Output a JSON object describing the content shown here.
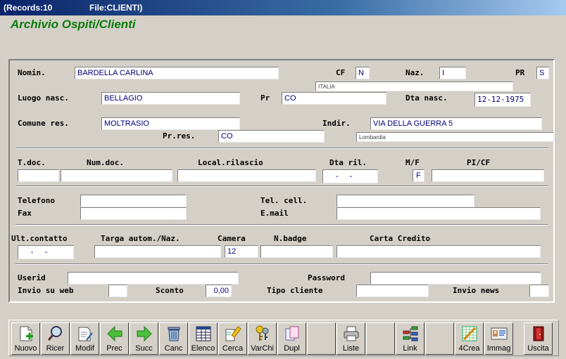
{
  "window": {
    "records": "(Records:10",
    "file": "File:CLIENTI)"
  },
  "app_title": "Archivio Ospiti/Clienti",
  "labels": {
    "nomin": "Nomin.",
    "cf": "CF",
    "naz": "Naz.",
    "pr": "PR",
    "luogo_nasc": "Luogo nasc.",
    "pr2": "Pr",
    "dta_nasc": "Dta nasc.",
    "comune_res": "Comune res.",
    "indir": "Indir.",
    "pr_res": "Pr.res.",
    "t_doc": "T.doc.",
    "num_doc": "Num.doc.",
    "local_rilascio": "Local.rilascio",
    "dta_ril": "Dta ril.",
    "mf": "M/F",
    "pi_cf": "PI/CF",
    "telefono": "Telefono",
    "tel_cell": "Tel. cell.",
    "fax": "Fax",
    "email": "E.mail",
    "ult_contatto": "Ult.contatto",
    "targa": "Targa autom./Naz.",
    "camera": "Camera",
    "n_badge": "N.badge",
    "carta_credito": "Carta Credito",
    "userid": "Userid",
    "password": "Password",
    "invio_web": "Invio su web",
    "sconto": "Sconto",
    "tipo_cliente": "Tipo cliente",
    "invio_news": "Invio news"
  },
  "values": {
    "nomin": "BARDELLA CARLINA",
    "cf": "N",
    "naz": "I",
    "pr": "S",
    "naz_desc": "ITALIA",
    "luogo_nasc": "BELLAGIO",
    "pr2": "CO",
    "dta_nasc": "12-12-1975",
    "comune_res": "MOLTRASIO",
    "indir": "VIA DELLA GUERRA 5",
    "pr_res": "CO",
    "regione": "Lombardia",
    "t_doc": "",
    "num_doc": "",
    "local_rilascio": "",
    "dta_ril": "  -  -",
    "mf": "F",
    "pi_cf": "",
    "telefono": "",
    "tel_cell": "",
    "fax": "",
    "email": "",
    "ult_contatto": "  -  -",
    "targa": "",
    "camera": "12",
    "n_badge": "",
    "carta_credito": "",
    "userid": "",
    "password": "",
    "invio_web": "",
    "sconto": "0,00",
    "tipo_cliente": "",
    "invio_news": ""
  },
  "toolbar": [
    {
      "label": "Nuovo",
      "icon": "new-document-icon"
    },
    {
      "label": "Ricer",
      "icon": "magnifier-icon"
    },
    {
      "label": "Modif",
      "icon": "edit-document-icon"
    },
    {
      "label": "Prec",
      "icon": "arrow-left-icon"
    },
    {
      "label": "Succ",
      "icon": "arrow-right-icon"
    },
    {
      "label": "Canc",
      "icon": "trash-icon"
    },
    {
      "label": "Elenco",
      "icon": "table-list-icon"
    },
    {
      "label": "Cerca",
      "icon": "search-highlighter-icon"
    },
    {
      "label": "VarChi",
      "icon": "keys-icon"
    },
    {
      "label": "Dupl",
      "icon": "duplicate-icon"
    },
    {
      "label": "",
      "icon": "empty"
    },
    {
      "label": "Liste",
      "icon": "printer-icon"
    },
    {
      "label": "",
      "icon": "empty"
    },
    {
      "label": "Link",
      "icon": "network-link-icon"
    },
    {
      "label": "",
      "icon": "empty"
    },
    {
      "label": "4Crea",
      "icon": "chart-create-icon"
    },
    {
      "label": "Immag",
      "icon": "id-card-icon"
    },
    {
      "label": "",
      "icon": "empty"
    },
    {
      "label": "Uscita",
      "icon": "exit-door-icon"
    }
  ],
  "colors": {
    "title_green": "#0a7a0a",
    "field_text": "#00007a",
    "background": "#d4d0c8"
  }
}
